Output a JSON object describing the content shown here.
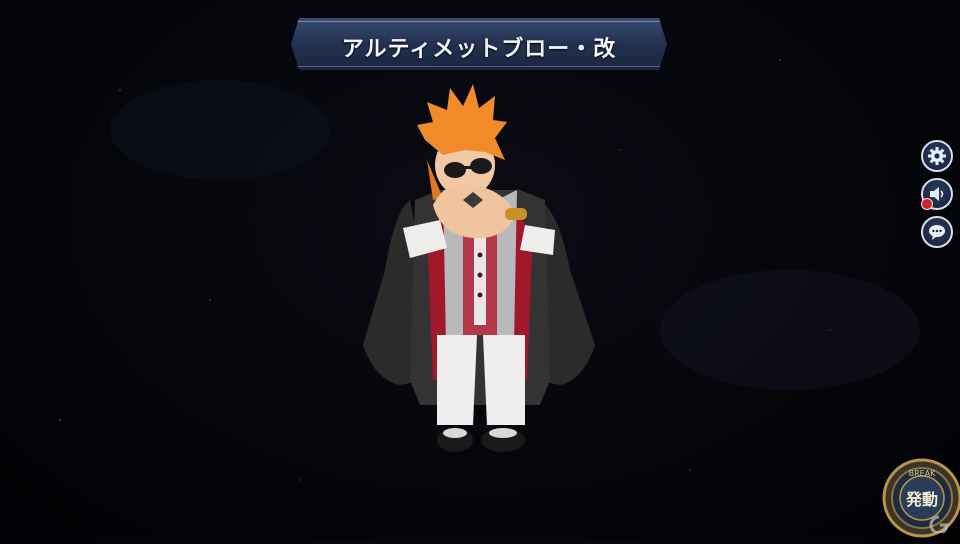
{
  "skill": {
    "name": "アルティメットブロー・改"
  },
  "side_menu": [
    {
      "icon": "gear-icon"
    },
    {
      "icon": "speaker-muted-icon"
    },
    {
      "icon": "chat-bubble-icon"
    }
  ],
  "emblem": {
    "top_text": "BREAK",
    "main_text": "発動"
  },
  "colors": {
    "banner": "#243353",
    "hair": "#f08a2a",
    "coat": "#2a2a2a",
    "lining": "#a0182a",
    "emblem_gold": "#b8954a"
  }
}
